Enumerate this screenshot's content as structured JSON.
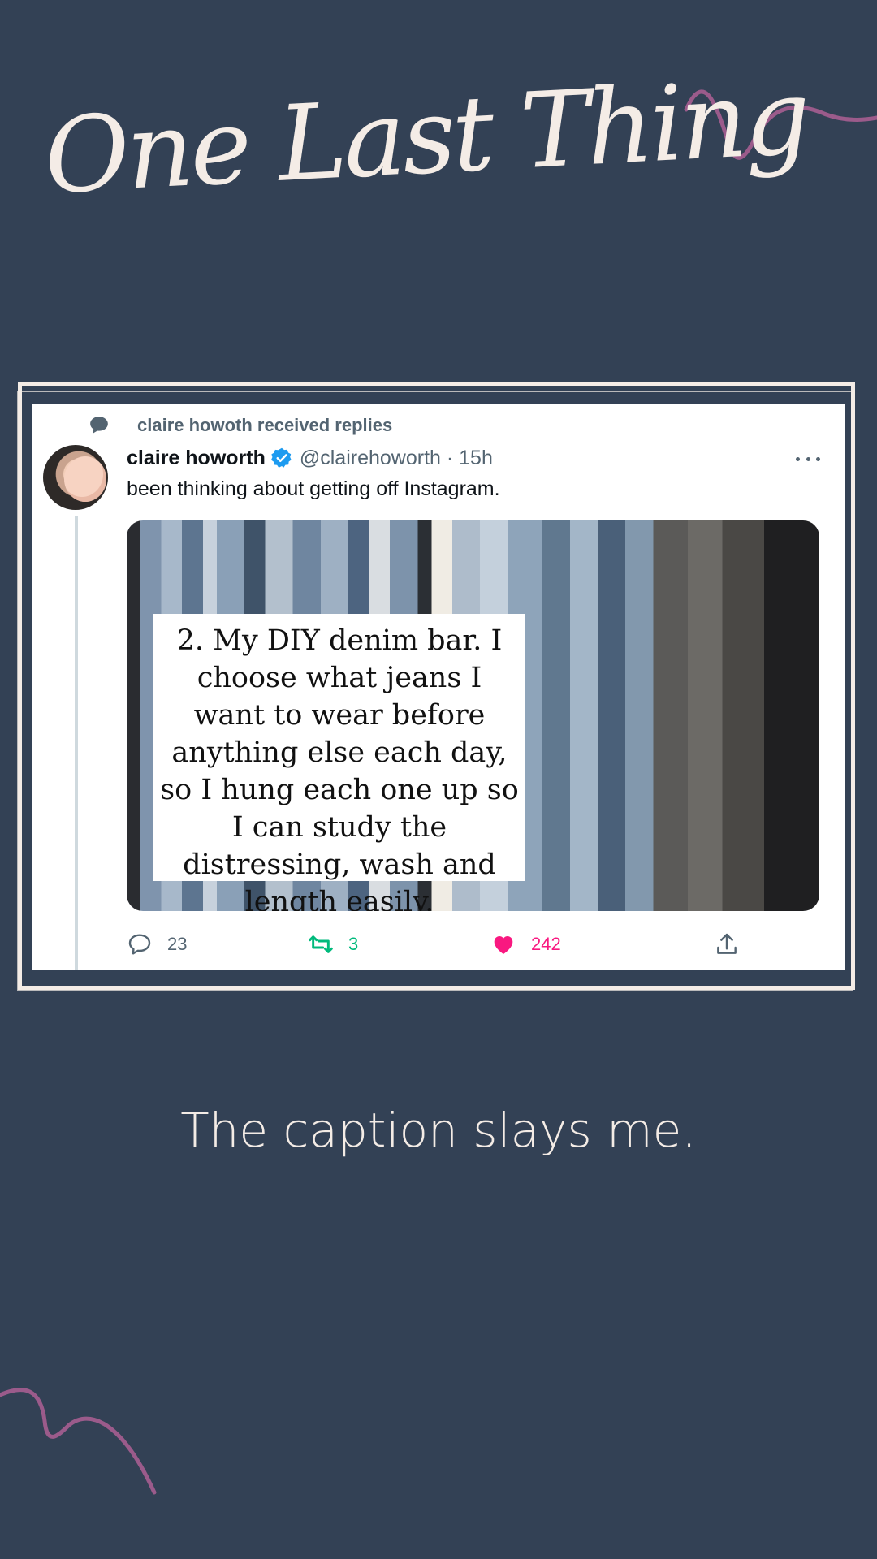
{
  "header": {
    "title": "One Last Thing"
  },
  "tweet": {
    "context": "claire howoth received replies",
    "author_name": "claire howorth",
    "handle_time": "@clairehoworth · 15h",
    "text": "been thinking about getting off Instagram.",
    "image_caption": "2. My DIY denim bar. I choose what jeans I want to wear before anything else each day, so I hung each one up so I can study the distressing, wash and length easily.",
    "stats": {
      "replies": "23",
      "retweets": "3",
      "likes": "242"
    }
  },
  "caption": "The caption slays me.",
  "colors": {
    "background": "#334155",
    "cream": "#f4ece6",
    "accent_squiggle": "#9b5b8b",
    "verified_blue": "#1d9bf0",
    "retweet_green": "#00ba7c",
    "like_pink": "#f91880"
  },
  "icons": [
    "speech-bubble-icon",
    "verified-badge-icon",
    "more-icon",
    "reply-icon",
    "retweet-icon",
    "heart-icon",
    "share-icon"
  ]
}
